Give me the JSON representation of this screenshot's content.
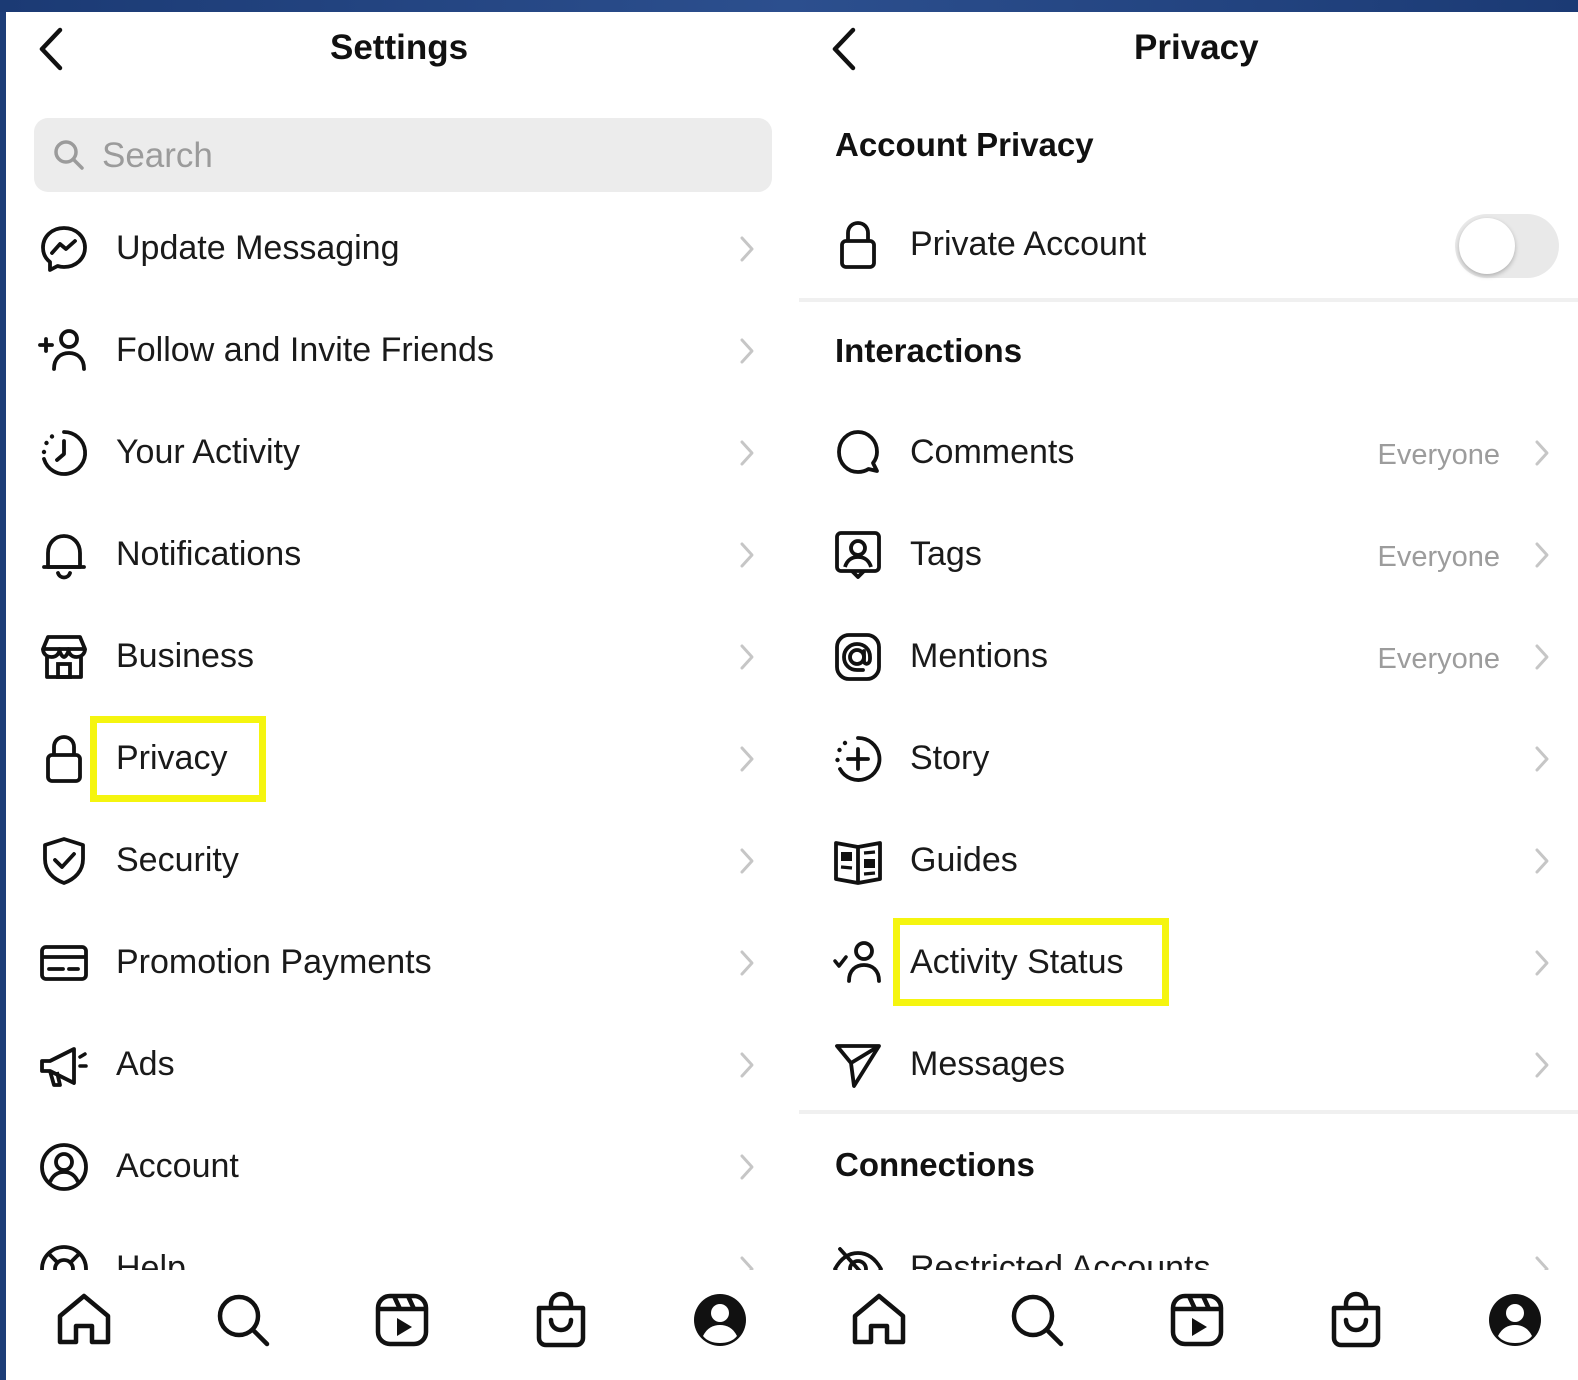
{
  "colors": {
    "background": "#1d3d78",
    "highlight": "#f5f50f",
    "secondary_text": "#9c9c9c",
    "toggle_off": "#e9e9e9"
  },
  "settings": {
    "title": "Settings",
    "search_placeholder": "Search",
    "items": [
      {
        "label": "Update Messaging",
        "icon": "messenger-icon"
      },
      {
        "label": "Follow and Invite Friends",
        "icon": "add-person-icon"
      },
      {
        "label": "Your Activity",
        "icon": "activity-clock-icon"
      },
      {
        "label": "Notifications",
        "icon": "bell-icon"
      },
      {
        "label": "Business",
        "icon": "shop-icon"
      },
      {
        "label": "Privacy",
        "icon": "lock-icon",
        "highlighted": true
      },
      {
        "label": "Security",
        "icon": "shield-check-icon"
      },
      {
        "label": "Promotion Payments",
        "icon": "card-icon"
      },
      {
        "label": "Ads",
        "icon": "megaphone-icon"
      },
      {
        "label": "Account",
        "icon": "account-circle-icon"
      },
      {
        "label": "Help",
        "icon": "lifebuoy-icon"
      }
    ]
  },
  "privacy": {
    "title": "Privacy",
    "account_privacy_header": "Account Privacy",
    "private_account": {
      "label": "Private Account",
      "icon": "lock-icon",
      "enabled": false
    },
    "interactions_header": "Interactions",
    "interactions": [
      {
        "label": "Comments",
        "value": "Everyone",
        "icon": "comment-bubble-icon"
      },
      {
        "label": "Tags",
        "value": "Everyone",
        "icon": "tag-person-icon"
      },
      {
        "label": "Mentions",
        "value": "Everyone",
        "icon": "at-sign-icon"
      },
      {
        "label": "Story",
        "value": "",
        "icon": "story-add-icon"
      },
      {
        "label": "Guides",
        "value": "",
        "icon": "guides-book-icon"
      },
      {
        "label": "Activity Status",
        "value": "",
        "icon": "activity-status-icon",
        "highlighted": true
      },
      {
        "label": "Messages",
        "value": "",
        "icon": "paper-plane-icon"
      }
    ],
    "connections_header": "Connections",
    "connections": [
      {
        "label": "Restricted Accounts",
        "icon": "restricted-eye-icon"
      }
    ]
  },
  "tabbar": [
    {
      "name": "home",
      "icon": "home-icon"
    },
    {
      "name": "search",
      "icon": "search-icon"
    },
    {
      "name": "reels",
      "icon": "reels-icon"
    },
    {
      "name": "shop",
      "icon": "shopping-bag-icon"
    },
    {
      "name": "profile",
      "icon": "profile-icon"
    }
  ]
}
